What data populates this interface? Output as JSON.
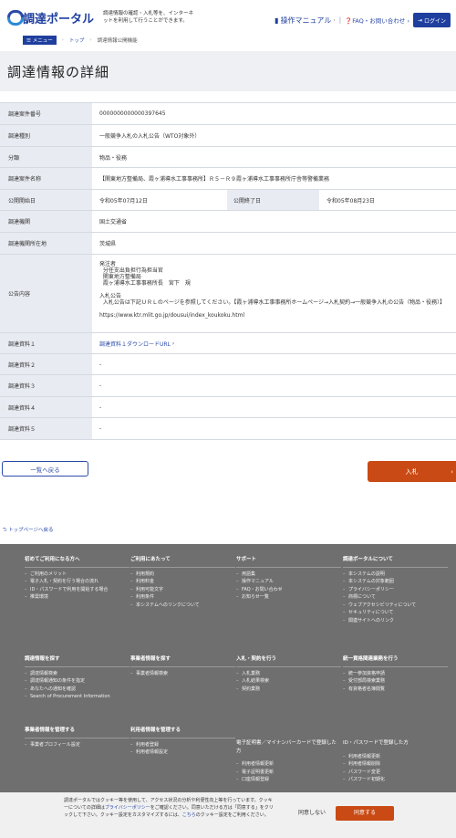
{
  "header": {
    "logo_text": "調達ポータル",
    "tagline": "調達情報の確認・入札等を、インターネットを利用して行うことができます。",
    "manual": "操作マニュアル",
    "faq": "FAQ・お問い合わせ",
    "login": "ログイン"
  },
  "crumb": {
    "menu": "メニュー",
    "top": "トップ",
    "current": "調達情報公開機能"
  },
  "page_title": "調達情報の詳細",
  "rows": {
    "r1": {
      "label": "調達案件番号",
      "value": "0000000000000397645"
    },
    "r2": {
      "label": "調達種別",
      "value": "一般競争入札の入札公告（WTO対象外）"
    },
    "r3": {
      "label": "分類",
      "value": "物品・役務"
    },
    "r4": {
      "label": "調達案件名称",
      "value": "【関東地方整備局、霞ヶ浦導水工事事務所】Ｒ５－Ｒ９霞ヶ浦導水工事事務所庁舎等警備業務"
    },
    "r5": {
      "label": "公開開始日",
      "value": "令和05年07月12日",
      "label2": "公開終了日",
      "value2": "令和05年08月23日"
    },
    "r6": {
      "label": "調達機関",
      "value": "国土交通省"
    },
    "r7": {
      "label": "調達機関所在地",
      "value": "茨城県"
    },
    "r8": {
      "label": "公告内容",
      "value": "発注者\n  分任支出負担行為担当官\n  関東地方整備局\n  霞ヶ浦導水工事事務所長　宮下　規\n\n入札公告\n  入札公告は下記ＵＲＬのページを参照してください。【霞ヶ浦導水工事事務所ホームページ→入札契約→一般競争入札の公告（物品・役務）】\n\nhttps://www.ktr.mlit.go.jp/dousui/index_koukoku.html"
    },
    "r9": {
      "label": "調達資料１",
      "value": "調達資料１ダウンロードURL"
    },
    "r10": {
      "label": "調達資料２",
      "value": "-"
    },
    "r11": {
      "label": "調達資料３",
      "value": "-"
    },
    "r12": {
      "label": "調達資料４",
      "value": "-"
    },
    "r13": {
      "label": "調達資料５",
      "value": "-"
    }
  },
  "buttons": {
    "back": "一覧へ戻る",
    "bid": "入札"
  },
  "toppage": "トップページへ戻る",
  "footer": {
    "c1": {
      "title": "初めてご利用になる方へ",
      "items": [
        "ご利用のメリット",
        "電子入札・契約を行う場合の流れ",
        "ID・パスワードで利用を開始する場合",
        "推奨環境"
      ]
    },
    "c2": {
      "title": "ご利用にあたって",
      "items": [
        "利用規約",
        "利用料金",
        "利用可能文字",
        "利用条件",
        "本システムへのリンクについて"
      ]
    },
    "c3": {
      "title": "サポート",
      "items": [
        "用語集",
        "操作マニュアル",
        "FAQ・お問い合わせ",
        "お知らせ一覧"
      ]
    },
    "c4": {
      "title": "調達ポータルについて",
      "items": [
        "本システムの説明",
        "本システムの対象範囲",
        "プライバシーポリシー",
        "商標について",
        "ウェブアクセシビリティについて",
        "セキュリティについて",
        "関連サイトへのリンク"
      ]
    },
    "c5": {
      "title": "調達情報を探す",
      "items": [
        "調達情報検索",
        "調達情報通知の条件を指定",
        "あなたへの通知を確認",
        "Search of Procurement Information"
      ]
    },
    "c6": {
      "title": "事業者情報を探す",
      "items": [
        "事業者情報検索"
      ]
    },
    "c7": {
      "title": "入札・契約を行う",
      "items": [
        "入札業務",
        "入札結果検索",
        "契約業務"
      ]
    },
    "c8": {
      "title": "統一資格関連業務を行う",
      "items": [
        "統一参加資格申請",
        "受付部局検索業務",
        "有資格者名簿閲覧"
      ]
    },
    "c9": {
      "title": "事業者情報を管理する",
      "items": [
        "事業者プロフィール設定"
      ]
    },
    "c10": {
      "title": "利用者情報を管理する",
      "items": [
        "利用者登録",
        "利用者情報設定"
      ]
    },
    "c11": {
      "title": "電子証明書／マイナンバーカードで登録した方",
      "items": [
        "利用者情報更新",
        "電子証明書更新",
        "口座情報登録"
      ]
    },
    "c12": {
      "title": "ID・パスワードで登録した方",
      "items": [
        "利用者情報更新",
        "利用者情報削除",
        "パスワード変更",
        "パスワード初期化"
      ]
    }
  },
  "cookie": {
    "text_a": "調達ポータルではクッキー等を使用して、アクセス状況の分析や利便性向上等を行っています。クッキーについての詳細は",
    "link_a": "プライバシーポリシー",
    "text_b": "をご確認ください。同意いただける方は「同意する」をクリックして下さい。クッキー設定をカスタマイズするには、",
    "link_b": "こちら",
    "text_c": "のクッキー設定をご利用ください。",
    "decline": "同意しない",
    "accept": "同意する"
  },
  "colors": {
    "brand": "#1f3f9e",
    "accent": "#c94a14",
    "footer_bg": "#6f6f6f"
  }
}
